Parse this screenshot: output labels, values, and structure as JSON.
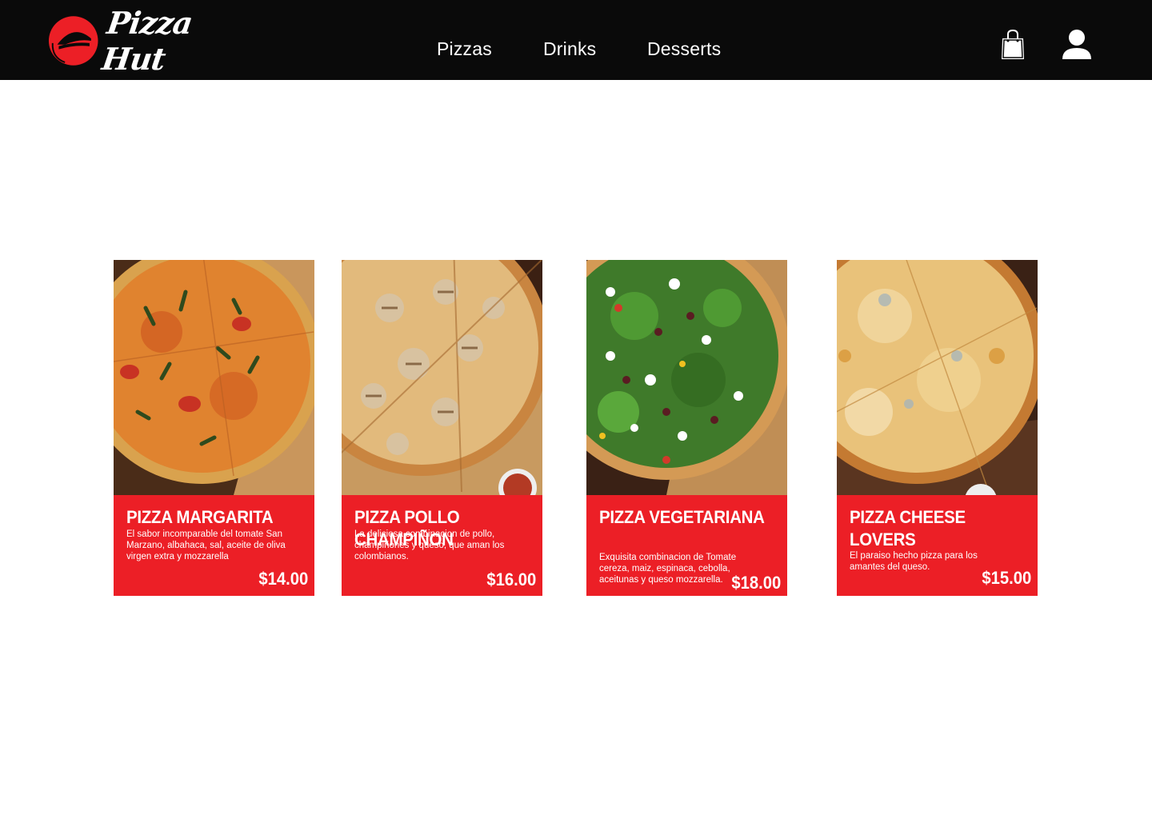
{
  "brand": {
    "name": "Pizza Hut",
    "primary_color": "#ec1f26",
    "header_color": "#0a0a0a"
  },
  "nav": {
    "items": [
      {
        "label": "Pizzas"
      },
      {
        "label": "Drinks"
      },
      {
        "label": "Desserts"
      }
    ]
  },
  "header_icons": {
    "cart": "shopping-bag-icon",
    "account": "user-icon"
  },
  "products": [
    {
      "title": "PIZZA MARGARITA",
      "description": "El sabor incomparable del tomate San Marzano, albahaca, sal, aceite de oliva virgen extra y mozzarella",
      "price": "$14.00"
    },
    {
      "title": "PIZZA POLLO CHAMPIÑON",
      "description": "La deliciosa combinacion de pollo, champiñones y queso, que aman los colombianos.",
      "price": "$16.00"
    },
    {
      "title": "PIZZA VEGETARIANA",
      "description": "Exquisita combinacion de Tomate cereza, maiz, espinaca, cebolla, aceitunas y queso mozzarella.",
      "price": "$18.00"
    },
    {
      "title": "PIZZA CHEESE LOVERS",
      "description": "El paraiso hecho pizza para los amantes del queso.",
      "price": "$15.00"
    }
  ]
}
